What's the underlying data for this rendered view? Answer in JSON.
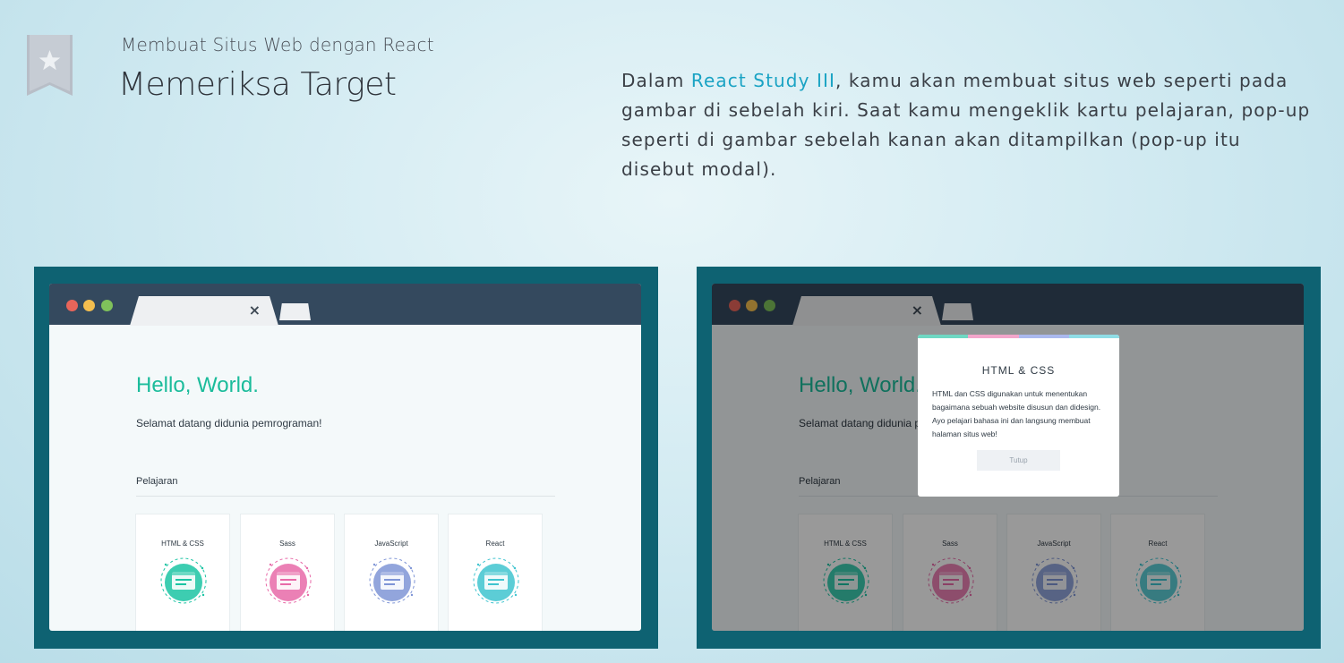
{
  "header": {
    "course_title": "Membuat Situs Web dengan React",
    "page_title": "Memeriksa Target",
    "bookmark_icon": "star-bookmark-icon"
  },
  "description": {
    "prefix": "Dalam ",
    "link": "React Study III",
    "suffix": ", kamu akan membuat situs web seperti pada gambar di sebelah kiri. Saat kamu mengeklik kartu pelajaran, pop-up seperti di gambar sebelah kanan akan ditampilkan (pop-up itu disebut modal)."
  },
  "browser": {
    "tab_close": "×"
  },
  "site": {
    "hello": "Hello, World.",
    "welcome": "Selamat datang didunia pemrograman!",
    "lessons_label": "Pelajaran",
    "cards": [
      {
        "title": "HTML & CSS",
        "color": "#1bc4a3",
        "icon": "html-css-icon"
      },
      {
        "title": "Sass",
        "color": "#e86aa8",
        "icon": "sass-icon"
      },
      {
        "title": "JavaScript",
        "color": "#7f95d6",
        "icon": "javascript-icon"
      },
      {
        "title": "React",
        "color": "#3fc4cf",
        "icon": "react-icon"
      }
    ]
  },
  "modal": {
    "title": "HTML & CSS",
    "body": "HTML dan CSS digunakan untuk menentukan bagaimana sebuah website disusun dan didesign. Ayo pelajari bahasa ini dan langsung membuat halaman situs web!",
    "close_label": "Tutup",
    "bar_colors": [
      "#6fd8c3",
      "#f3a6cb",
      "#aab9ee",
      "#8fdde6"
    ]
  },
  "colors": {
    "accent": "#1aa3c4",
    "frame": "#0e6272",
    "titlebar": "#34495e",
    "hello": "#1bbc9b"
  }
}
